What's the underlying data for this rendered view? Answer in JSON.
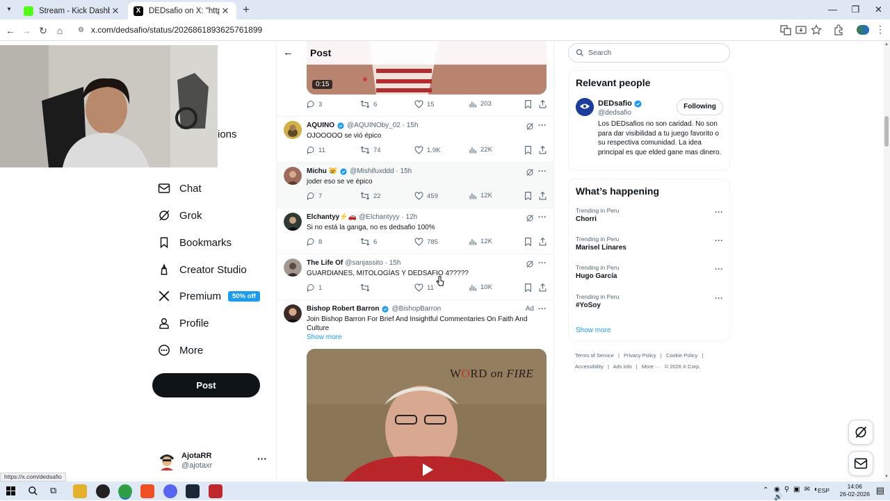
{
  "browser": {
    "tabs": [
      {
        "title": "Stream - Kick Dashboard",
        "favicon_color": "#53fc18"
      },
      {
        "title": "DEDsafio on X: \"https://t.co/nq",
        "favicon_color": "#000000"
      }
    ],
    "url": "x.com/dedsafio/status/2026861893625761899",
    "status_url": "https://x.com/dedsafio"
  },
  "sidebar": {
    "partial_label": "ions",
    "items": [
      {
        "label": "Chat",
        "icon": "envelope-icon"
      },
      {
        "label": "Grok",
        "icon": "grok-icon"
      },
      {
        "label": "Bookmarks",
        "icon": "bookmark-icon"
      },
      {
        "label": "Creator Studio",
        "icon": "creator-studio-icon"
      },
      {
        "label": "Premium",
        "icon": "x-logo-icon",
        "badge": "50% off"
      },
      {
        "label": "Profile",
        "icon": "person-icon"
      },
      {
        "label": "More",
        "icon": "more-circle-icon"
      }
    ],
    "post_button": "Post",
    "account": {
      "name": "AjotaRR",
      "handle": "@ajotaxr"
    }
  },
  "timeline": {
    "header_title": "Post",
    "video_time": "0:15",
    "top_stats": {
      "replies": "3",
      "reposts": "6",
      "likes": "15",
      "views": "203"
    },
    "replies": [
      {
        "name": "AQUINO",
        "verified": true,
        "handle": "@AQUINOby_02",
        "time": "· 15h",
        "text": "OJOOOOO se vió épico",
        "replies": "11",
        "reposts": "74",
        "likes": "1.9K",
        "views": "22K",
        "avatar_color": "#c9a227"
      },
      {
        "name": "Michu 😿",
        "verified": true,
        "handle": "@Mishifuxddd",
        "time": "· 15h",
        "text": "joder eso se ve épico",
        "replies": "7",
        "reposts": "22",
        "likes": "459",
        "views": "12K",
        "avatar_color": "#8a5a4a"
      },
      {
        "name": "Elchantyy⚡🚗",
        "verified": false,
        "handle": "@Elchantyyy",
        "time": "· 12h",
        "text": "Si no está la ganga, no es dedsafio 100%",
        "replies": "8",
        "reposts": "6",
        "likes": "785",
        "views": "12K",
        "avatar_color": "#2f3b34"
      },
      {
        "name": "The Life Of",
        "verified": false,
        "handle": "@sanjassito",
        "time": "· 15h",
        "text": "GUARDIANES, MITOLOGÍAS Y DEDSAFIO 4?????",
        "replies": "1",
        "reposts": "",
        "likes": "11",
        "views": "10K",
        "avatar_color": "#6b5d55"
      }
    ],
    "ad": {
      "name": "Bishop Robert Barron",
      "handle": "@BishopBarron",
      "label": "Ad",
      "text": "Join Bishop Barron For Brief And Insightful Commentaries On Faith And Culture",
      "show_more": "Show more",
      "video_brand_1": "W",
      "video_brand_2": "RD",
      "video_brand_3": "on FIRE"
    }
  },
  "right": {
    "search_placeholder": "Search",
    "relevant_people": {
      "title": "Relevant people",
      "name": "DEDsafio",
      "handle": "@dedsafio",
      "button": "Following",
      "bio": "Los DEDsafios no son caridad. No son para dar visibilidad a tu juego favorito o su respectiva comunidad. La idea principal es que elded gane mas dinero."
    },
    "happening": {
      "title": "What’s happening",
      "trends": [
        {
          "context": "Trending in Peru",
          "name": "Chorri"
        },
        {
          "context": "Trending in Peru",
          "name": "Marisel Linares"
        },
        {
          "context": "Trending in Peru",
          "name": "Hugo García"
        },
        {
          "context": "Trending in Peru",
          "name": "#YoSoy"
        }
      ],
      "show_more": "Show more"
    },
    "footer": [
      "Terms of Service",
      "|",
      "Privacy Policy",
      "|",
      "Cookie Policy",
      "|",
      "Accessibility",
      "|",
      "Ads info",
      "|",
      "More ···",
      "© 2026 X Corp."
    ]
  },
  "taskbar": {
    "lang": "ESP",
    "time": "14:06",
    "date": "26-02-2026"
  },
  "colors": {
    "accent": "#1d9bf0",
    "text": "#0f1419",
    "muted": "#536471"
  }
}
